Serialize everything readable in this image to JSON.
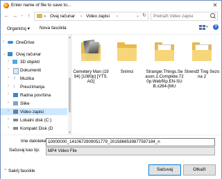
{
  "window": {
    "title": "Enter name of file to save to...",
    "close_glyph": "✕"
  },
  "address": {
    "back_glyph": "←",
    "forward_glyph": "→",
    "up_glyph": "↑",
    "crumbs": [
      "»",
      "Ovaj računar",
      "›",
      "Video zapisi",
      "›"
    ],
    "dropdown_glyph": "⌄",
    "refresh_glyph": "↻",
    "search_placeholder": "Pretraži Video zapisi"
  },
  "toolbar": {
    "organize_label": "Organizuj ▾",
    "new_folder_label": "Nova fascikla",
    "help_glyph": "?"
  },
  "sidebar": {
    "items": [
      {
        "label": "OneDrive",
        "icon": "cloud-icon",
        "color": "#2d8fdd",
        "expand": "›"
      },
      {
        "label": "Ovaj računar",
        "icon": "computer-icon",
        "color": "#3b87c9",
        "expand": "⌄"
      },
      {
        "label": "3D objekti",
        "icon": "cube-icon",
        "color": "#51a7e0",
        "expand": "›"
      },
      {
        "label": "Dokumenti",
        "icon": "documents-icon",
        "color": "#8aa4c7",
        "expand": "›"
      },
      {
        "label": "Muzika",
        "icon": "music-icon",
        "color": "#5b8ad1",
        "expand": "›"
      },
      {
        "label": "Preuzimanja",
        "icon": "download-icon",
        "color": "#3b87c9",
        "expand": "›"
      },
      {
        "label": "Radna površina",
        "icon": "desktop-icon",
        "color": "#3b87c9",
        "expand": "›"
      },
      {
        "label": "Slike",
        "icon": "pictures-icon",
        "color": "#7aa5cf",
        "expand": "›"
      },
      {
        "label": "Video zapisi",
        "icon": "video-icon",
        "color": "#6b7f94",
        "expand": "›",
        "selected": true
      },
      {
        "label": "Lokalni disk (C:)",
        "icon": "drive-icon",
        "color": "#7d8c9c",
        "expand": "›"
      },
      {
        "label": "Kompakt Disk (D",
        "icon": "cd-icon",
        "color": "#8a8a8a",
        "expand": "›"
      }
    ]
  },
  "files": [
    {
      "name": "Cemetery Man (1994) [1080p] [YTS.AG]",
      "icon": "folder-with-image-icon"
    },
    {
      "name": "Snimci",
      "icon": "folder-icon"
    },
    {
      "name": "Stranger.Things.Season.1.Complete.720p.WebRip.EN-SUB.x264-[MU",
      "icon": "folder-with-files-icon"
    },
    {
      "name": "Strendž Ting Sezona 2",
      "icon": "folder-with-files-icon"
    }
  ],
  "footer": {
    "filename_label": "Ime datoteke:",
    "filename_value": "10000000_1410672909051779_2015866539877597184_n",
    "filetype_label": "Sačuvaj kao tip:",
    "filetype_value": "MP4 Video File",
    "hide_folders_label": "Sakrij fascikle",
    "save_label": "Sačuvaj",
    "cancel_label": "Otkaži"
  }
}
